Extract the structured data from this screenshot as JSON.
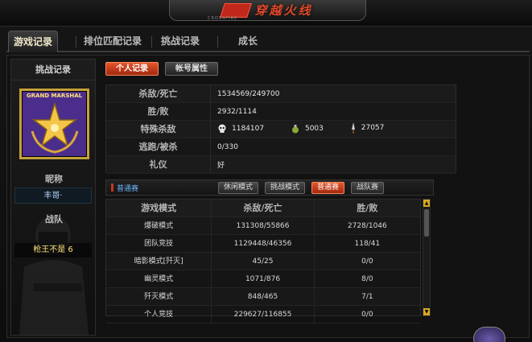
{
  "header": {
    "logo_text": "穿越火线",
    "logo_sub": "CROSSFIRE"
  },
  "tabs": [
    {
      "label": "游戏记录",
      "active": true
    },
    {
      "label": "排位匹配记录",
      "active": false
    },
    {
      "label": "挑战记录",
      "active": false
    },
    {
      "label": "成长",
      "active": false
    }
  ],
  "left": {
    "title": "挑战记录",
    "badge_text": "GRAND MARSHAL",
    "rank_label": "昵称",
    "nickname": "丰哥·",
    "team_label": "战队",
    "team_name": "枪王不是 6"
  },
  "subtabs": {
    "personal": "个人记录",
    "account": "帐号属性"
  },
  "stats": [
    {
      "label": "杀敌/死亡",
      "value": "1534569/249700"
    },
    {
      "label": "胜/败",
      "value": "2932/1114"
    },
    {
      "label": "特殊杀敌",
      "kills": [
        {
          "icon": "skull-icon",
          "value": "1184107"
        },
        {
          "icon": "grenade-icon",
          "value": "5003"
        },
        {
          "icon": "knife-icon",
          "value": "27057"
        }
      ]
    },
    {
      "label": "逃跑/被杀",
      "value": "0/330"
    },
    {
      "label": "礼仪",
      "value": "好"
    }
  ],
  "modes": {
    "title": "普通赛",
    "buttons": [
      {
        "label": "休闲模式",
        "style": "dark"
      },
      {
        "label": "挑战模式",
        "style": "dark"
      },
      {
        "label": "普通赛",
        "style": "red"
      },
      {
        "label": "战队赛",
        "style": "dark"
      }
    ]
  },
  "table": {
    "headers": [
      "游戏模式",
      "杀敌/死亡",
      "胜/败"
    ],
    "rows": [
      [
        "爆破模式",
        "131308/55866",
        "2728/1046"
      ],
      [
        "团队竞技",
        "1129448/46356",
        "118/41"
      ],
      [
        "暗影模式[歼灭]",
        "45/25",
        "0/0"
      ],
      [
        "幽灵模式",
        "1071/876",
        "8/0"
      ],
      [
        "歼灭模式",
        "848/465",
        "7/1"
      ],
      [
        "个人竞技",
        "229627/116855",
        "0/0"
      ]
    ]
  },
  "colors": {
    "accent_red": "#c43820",
    "gold": "#c4a23a",
    "badge_purple": "#4b2d8c"
  }
}
